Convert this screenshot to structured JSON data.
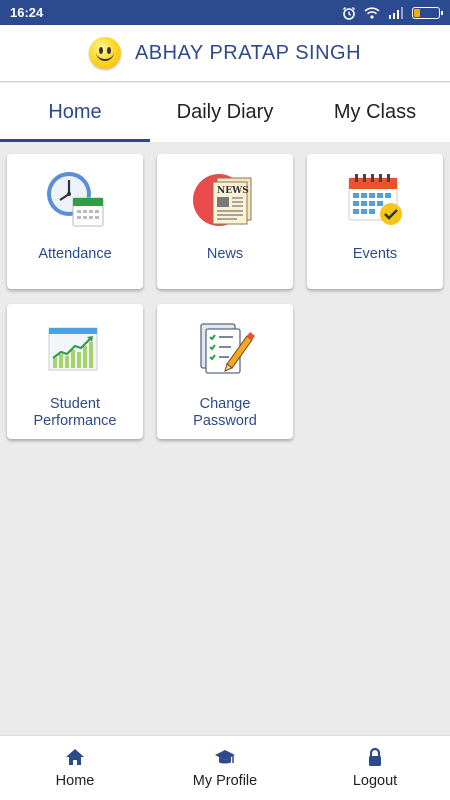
{
  "status_bar": {
    "time": "16:24"
  },
  "header": {
    "user_name": "ABHAY PRATAP SINGH"
  },
  "tabs": [
    {
      "label": "Home",
      "active": true
    },
    {
      "label": "Daily Diary",
      "active": false
    },
    {
      "label": "My Class",
      "active": false
    }
  ],
  "tiles": [
    {
      "label": "Attendance",
      "icon": "clock-calendar-icon"
    },
    {
      "label": "News",
      "icon": "newspaper-icon"
    },
    {
      "label": "Events",
      "icon": "calendar-check-icon"
    },
    {
      "label": "Student\nPerformance",
      "icon": "growth-chart-icon"
    },
    {
      "label": "Change\nPassword",
      "icon": "checklist-pencil-icon"
    }
  ],
  "bottom_nav": [
    {
      "label": "Home",
      "icon": "home-icon"
    },
    {
      "label": "My Profile",
      "icon": "graduation-cap-icon"
    },
    {
      "label": "Logout",
      "icon": "lock-icon"
    }
  ],
  "colors": {
    "status_bar": "#2b4a8f",
    "accent": "#2c4a8c",
    "background": "#ebebeb",
    "battery": "#f2a91a"
  }
}
